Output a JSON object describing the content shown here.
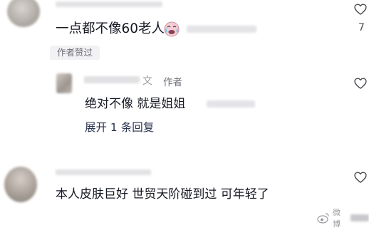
{
  "comments": [
    {
      "text": "一点都不像60老人",
      "emoji": "crying-laughing-face-emoji",
      "badge": "作者赞过",
      "like_count": "7"
    },
    {
      "author_tag": "作者",
      "text": "绝对不像 就是姐姐",
      "expand_label": "展开 1 条回复"
    },
    {
      "text": "本人皮肤巨好 世贸天阶碰到过 可年轻了"
    }
  ],
  "reply_name_fragment": "文",
  "watermark": "微博"
}
